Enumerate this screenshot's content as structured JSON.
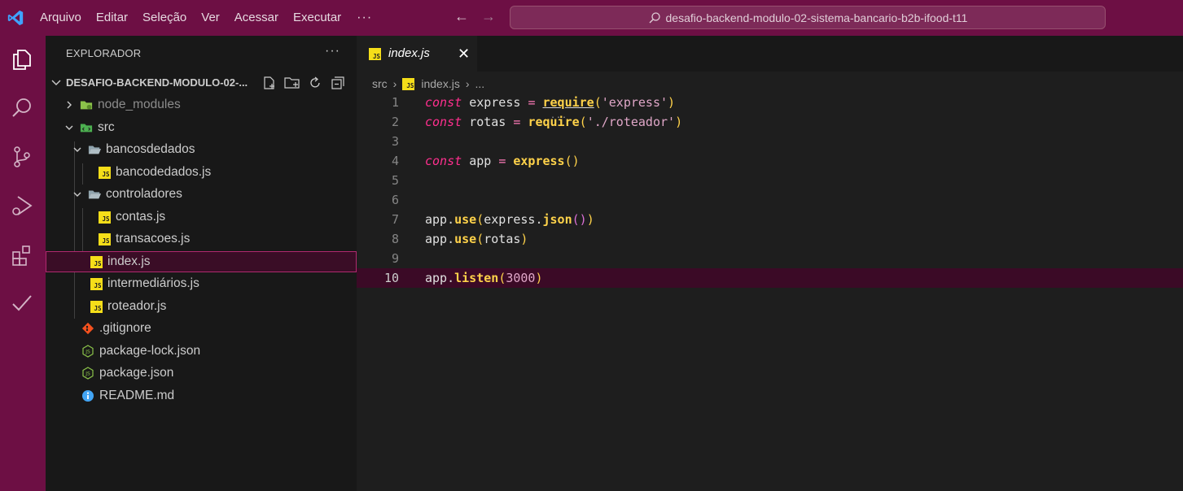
{
  "menu": {
    "items": [
      "Arquivo",
      "Editar",
      "Seleção",
      "Ver",
      "Acessar",
      "Executar"
    ],
    "more": "···"
  },
  "search": {
    "text": "desafio-backend-modulo-02-sistema-bancario-b2b-ifood-t11"
  },
  "sidebar": {
    "header": "EXPLORADOR",
    "more": "···",
    "folder_title": "DESAFIO-BACKEND-MODULO-02-...",
    "tree": [
      {
        "label": "node_modules",
        "icon": "node-modules-folder-icon",
        "dim": true
      },
      {
        "label": "src",
        "icon": "src-folder-icon"
      },
      {
        "label": "bancosdedados",
        "icon": "folder-open-icon"
      },
      {
        "label": "bancodedados.js",
        "icon": "js-file-icon"
      },
      {
        "label": "controladores",
        "icon": "folder-open-icon"
      },
      {
        "label": "contas.js",
        "icon": "js-file-icon"
      },
      {
        "label": "transacoes.js",
        "icon": "js-file-icon"
      },
      {
        "label": "index.js",
        "icon": "js-file-icon",
        "selected": true
      },
      {
        "label": "intermediários.js",
        "icon": "js-file-icon"
      },
      {
        "label": "roteador.js",
        "icon": "js-file-icon"
      },
      {
        "label": ".gitignore",
        "icon": "git-icon"
      },
      {
        "label": "package-lock.json",
        "icon": "nodejs-icon"
      },
      {
        "label": "package.json",
        "icon": "nodejs-icon"
      },
      {
        "label": "README.md",
        "icon": "info-icon"
      }
    ]
  },
  "editor": {
    "tab_label": "index.js",
    "tab_badge": "JS",
    "breadcrumb": {
      "folder": "src",
      "file": "index.js",
      "more": "..."
    },
    "line_numbers": [
      "1",
      "2",
      "3",
      "4",
      "5",
      "6",
      "7",
      "8",
      "9",
      "10"
    ],
    "current_line": 10
  },
  "colors": {
    "titlebar": "#6d0f44",
    "keyword": "#ff2f8e",
    "function": "#ffd24a",
    "string": "#e0a7c8",
    "current_line": "#3b0a26"
  }
}
